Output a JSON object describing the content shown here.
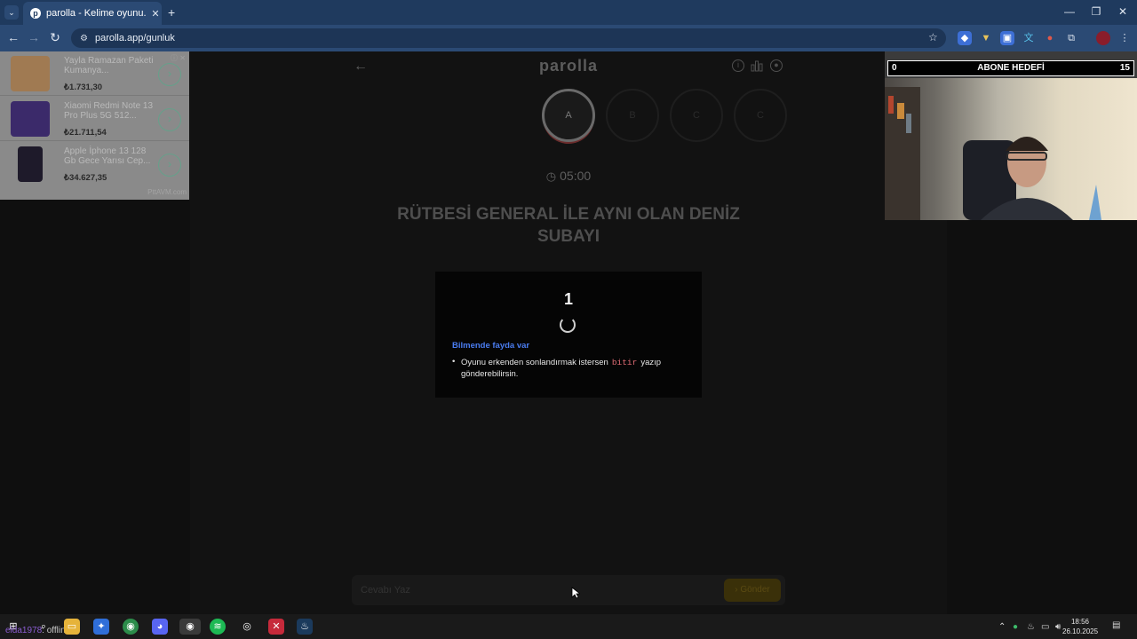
{
  "browser": {
    "tab_title": "parolla - Kelime oyunu. Günlük",
    "tab_close": "✕",
    "new_tab": "+",
    "url": "parolla.app/gunluk",
    "window_controls": {
      "minimize": "—",
      "restore": "❐",
      "close": "✕"
    }
  },
  "app": {
    "logo": "parolla",
    "letters": [
      "A",
      "B",
      "C",
      "C"
    ],
    "timer": "05:00",
    "question": "RÜTBESİ GENERAL İLE AYNI OLAN DENİZ SUBAYI",
    "modal": {
      "countdown": "1",
      "tip_title": "Bilmende fayda var",
      "tip_before": "Oyunu erkenden sonlandırmak istersen",
      "tip_code": "bitir",
      "tip_after": "yazıp gönderebilirsin."
    },
    "answer_placeholder": "Cevabı Yaz",
    "send_label": "Gönder"
  },
  "ad": {
    "items": [
      {
        "name": "Yayla Ramazan Paketi Kumanya...",
        "price": "₺1.731,30"
      },
      {
        "name": "Xiaomi Redmi Note 13 Pro Plus 5G 512...",
        "price": "₺21.711,54"
      },
      {
        "name": "Apple İphone 13 128 Gb Gece Yarısı Cep...",
        "price": "₺34.627,35"
      }
    ],
    "source": "PttAVM.com"
  },
  "overlay": {
    "goal_min": "0",
    "goal_label": "ABONE HEDEFİ",
    "goal_max": "15"
  },
  "taskbar": {
    "user": "elda1978",
    "status": ": offline",
    "time": "18:56",
    "date": "26.10.2025"
  }
}
